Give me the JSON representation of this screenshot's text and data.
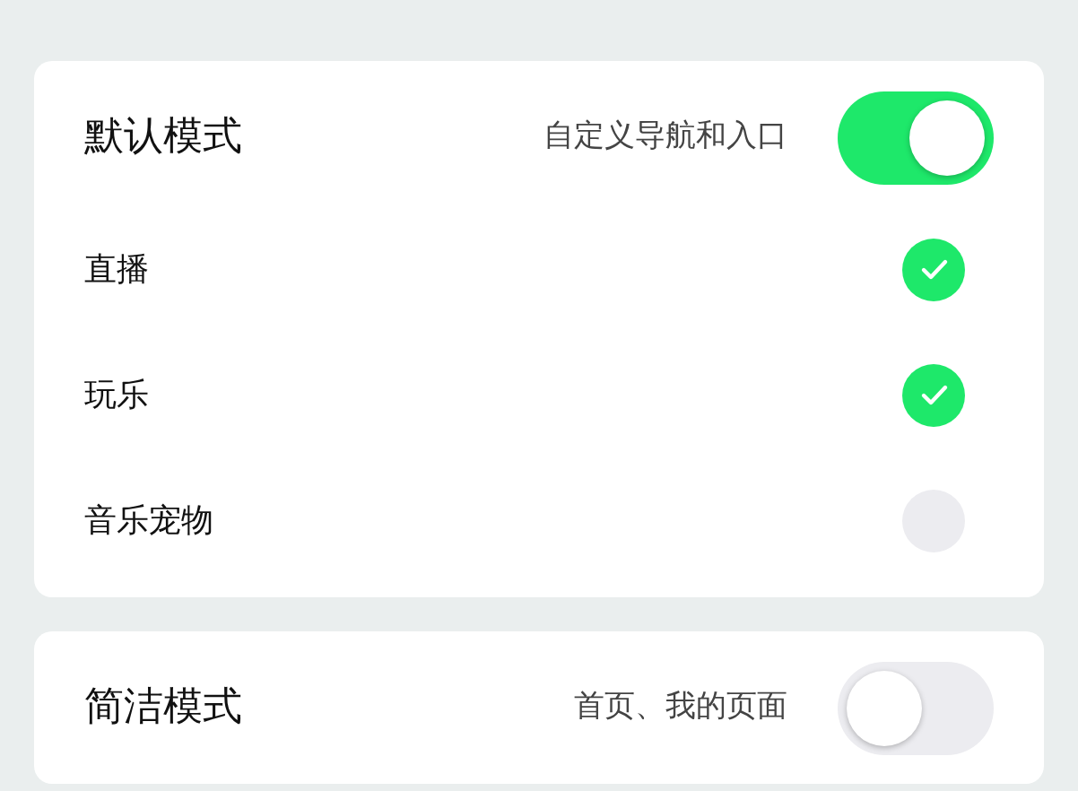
{
  "modes": [
    {
      "title": "默认模式",
      "description": "自定义导航和入口",
      "on": true,
      "items": [
        {
          "label": "直播",
          "checked": true
        },
        {
          "label": "玩乐",
          "checked": true
        },
        {
          "label": "音乐宠物",
          "checked": false
        }
      ]
    },
    {
      "title": "简洁模式",
      "description": "首页、我的页面",
      "on": false
    }
  ]
}
